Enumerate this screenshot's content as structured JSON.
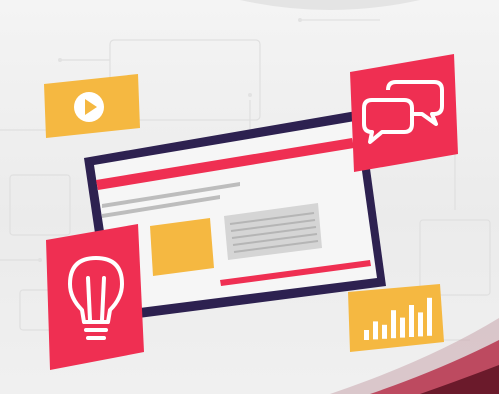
{
  "illustration": {
    "icons": [
      "play-icon",
      "chat-bubbles-icon",
      "lightbulb-icon",
      "bar-chart-icon"
    ],
    "bar_chart_levels": [
      0.25,
      0.45,
      0.35,
      0.7,
      0.5,
      0.8,
      0.6,
      0.95
    ],
    "colors": {
      "accent_red": "#ef2f52",
      "accent_yellow": "#f5b841",
      "monitor_frame": "#2d2150",
      "screen": "#f6f6f6",
      "placeholder_gray": "#cfcfcf",
      "background": "#efefef",
      "swoosh_dark": "#6b1a2b"
    }
  }
}
